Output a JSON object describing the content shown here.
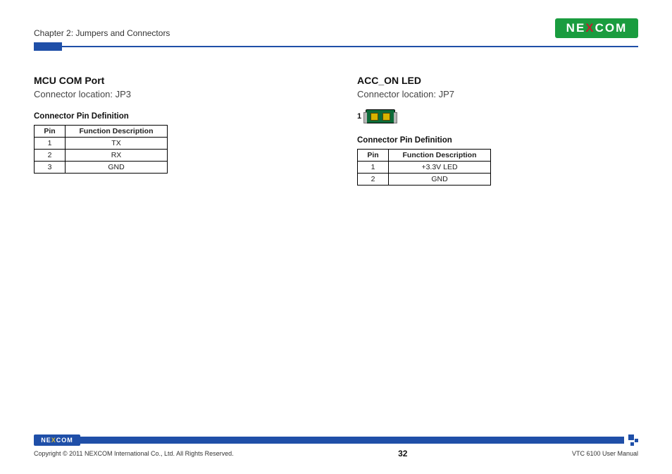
{
  "header": {
    "chapter_title": "Chapter 2: Jumpers and Connectors",
    "logo_text_pre": "NE",
    "logo_text_x": "X",
    "logo_text_post": "COM"
  },
  "left": {
    "title": "MCU COM Port",
    "subtitle": "Connector location: JP3",
    "table_caption": "Connector Pin Definition",
    "columns": {
      "pin": "Pin",
      "func": "Function Description"
    },
    "rows": [
      {
        "pin": "1",
        "func": "TX"
      },
      {
        "pin": "2",
        "func": "RX"
      },
      {
        "pin": "3",
        "func": "GND"
      }
    ]
  },
  "right": {
    "title": "ACC_ON LED",
    "subtitle": "Connector location: JP7",
    "diagram_label": "1",
    "table_caption": "Connector Pin Definition",
    "columns": {
      "pin": "Pin",
      "func": "Function Description"
    },
    "rows": [
      {
        "pin": "1",
        "func": "+3.3V LED"
      },
      {
        "pin": "2",
        "func": "GND"
      }
    ]
  },
  "footer": {
    "logo_text_pre": "NE",
    "logo_text_x": "X",
    "logo_text_post": "COM",
    "copyright": "Copyright © 2011 NEXCOM International Co., Ltd. All Rights Reserved.",
    "page_number": "32",
    "doc_ref": "VTC 6100 User Manual"
  }
}
